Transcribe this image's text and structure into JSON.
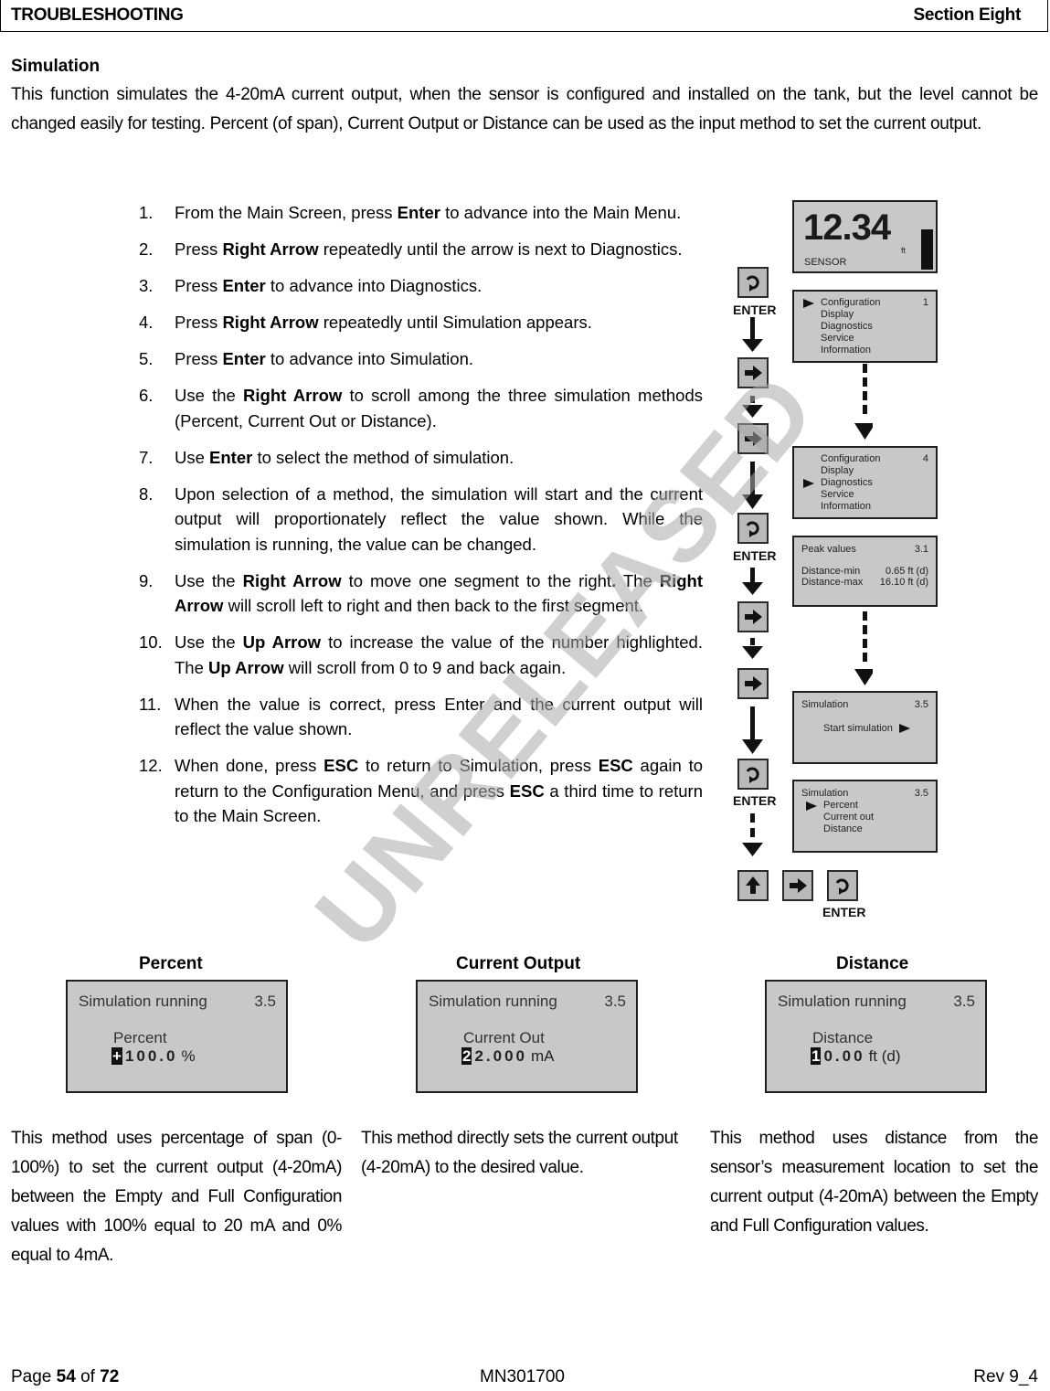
{
  "header": {
    "left": "TROUBLESHOOTING",
    "right": "Section Eight"
  },
  "section": {
    "title": "Simulation",
    "intro": "This function simulates the 4-20mA current output, when the sensor is configured and installed on the tank, but the level cannot be changed easily for testing. Percent (of span), Current Output or Distance can be used as the input method to set the current output."
  },
  "steps": [
    {
      "num": "1.",
      "parts": [
        [
          "From the Main Screen, press ",
          false
        ],
        [
          "Enter",
          true
        ],
        [
          " to advance into the Main Menu.",
          false
        ]
      ]
    },
    {
      "num": "2.",
      "parts": [
        [
          "Press ",
          false
        ],
        [
          "Right Arrow",
          true
        ],
        [
          " repeatedly until the arrow is next to Diagnostics.",
          false
        ]
      ]
    },
    {
      "num": "3.",
      "parts": [
        [
          "Press ",
          false
        ],
        [
          "Enter",
          true
        ],
        [
          " to advance into Diagnostics.",
          false
        ]
      ]
    },
    {
      "num": "4.",
      "parts": [
        [
          "Press ",
          false
        ],
        [
          "Right Arrow",
          true
        ],
        [
          " repeatedly until Simulation appears.",
          false
        ]
      ]
    },
    {
      "num": "5.",
      "parts": [
        [
          "Press ",
          false
        ],
        [
          "Enter",
          true
        ],
        [
          " to advance into Simulation.",
          false
        ]
      ]
    },
    {
      "num": "6.",
      "parts": [
        [
          "Use the ",
          false
        ],
        [
          "Right Arrow",
          true
        ],
        [
          " to scroll among the three simulation methods (Percent, Current Out or Distance).",
          false
        ]
      ]
    },
    {
      "num": "7.",
      "parts": [
        [
          "Use ",
          false
        ],
        [
          "Enter",
          true
        ],
        [
          " to select the method of simulation.",
          false
        ]
      ]
    },
    {
      "num": "8.",
      "parts": [
        [
          "Upon selection of a method, the simulation will start and the current output will proportionately reflect the value shown. While the simulation is running, the value can be changed.",
          false
        ]
      ]
    },
    {
      "num": "9.",
      "parts": [
        [
          "Use the ",
          false
        ],
        [
          "Right Arrow",
          true
        ],
        [
          " to move one segment to the right",
          false
        ],
        [
          ".",
          true
        ],
        [
          "  The ",
          false
        ],
        [
          "Right Arrow",
          true
        ],
        [
          " will scroll left to right and then back to the first segment.",
          false
        ]
      ]
    },
    {
      "num": "10.",
      "parts": [
        [
          "Use the ",
          false
        ],
        [
          "Up Arrow",
          true
        ],
        [
          " to increase the value of the number highlighted.  The ",
          false
        ],
        [
          "Up Arrow",
          true
        ],
        [
          " will scroll from 0 to 9 and back again.",
          false
        ]
      ]
    },
    {
      "num": "11.",
      "parts": [
        [
          "When the value is correct, press Enter and the current output will reflect the value shown.",
          false
        ]
      ]
    },
    {
      "num": "12.",
      "parts": [
        [
          "When done, press ",
          false
        ],
        [
          "ESC",
          true
        ],
        [
          " to return to Simulation, press ",
          false
        ],
        [
          "ESC",
          true
        ],
        [
          " again to return to the Configuration Menu, and press ",
          false
        ],
        [
          "ESC",
          true
        ],
        [
          " a third time to return to the Main Screen.",
          false
        ]
      ]
    }
  ],
  "diagram": {
    "enter_label": "ENTER",
    "main_screen": {
      "value": "12.34",
      "unit": "ft",
      "label": "SENSOR"
    },
    "menu1": {
      "items": [
        "Configuration",
        "Display",
        "Diagnostics",
        "Service",
        "Information"
      ],
      "selected": 0,
      "index": "1"
    },
    "menu2": {
      "items": [
        "Configuration",
        "Display",
        "Diagnostics",
        "Service",
        "Information"
      ],
      "selected": 2,
      "index": "4"
    },
    "peak": {
      "title": "Peak values",
      "index": "3.1",
      "rows": [
        {
          "label": "Distance-min",
          "value": "0.65 ft (d)"
        },
        {
          "label": "Distance-max",
          "value": "16.10 ft (d)"
        }
      ]
    },
    "sim_start": {
      "title": "Simulation",
      "index": "3.5",
      "action": "Start simulation"
    },
    "sim_select": {
      "title": "Simulation",
      "index": "3.5",
      "items": [
        "Percent",
        "Current out",
        "Distance"
      ],
      "selected": 0
    }
  },
  "methods": [
    {
      "heading": "Percent",
      "title": "Simulation running",
      "index": "3.5",
      "label": "Percent",
      "highlight": "+",
      "value": "100.0",
      "unit": "%",
      "description": "This method uses percentage of span (0-100%) to set the current output (4-20mA) between the Empty and Full Configuration values with 100% equal to 20 mA and 0% equal to 4mA."
    },
    {
      "heading": "Current Output",
      "title": "Simulation running",
      "index": "3.5",
      "label": "Current Out",
      "highlight": "2",
      "value": "2.000",
      "unit": "mA",
      "description": "This method directly sets the current output (4-20mA) to the desired value."
    },
    {
      "heading": "Distance",
      "title": "Simulation running",
      "index": "3.5",
      "label": "Distance",
      "highlight": "1",
      "value": "0.00",
      "unit": "ft (d)",
      "description": "This method uses distance from the sensor’s measurement location to set the current output (4-20mA) between the Empty and Full Configuration values."
    }
  ],
  "watermark": "UNRELEASED",
  "footer": {
    "page_prefix": "Page ",
    "page": "54",
    "of": " of ",
    "total": "72",
    "doc": "MN301700",
    "rev": "Rev 9_4"
  }
}
